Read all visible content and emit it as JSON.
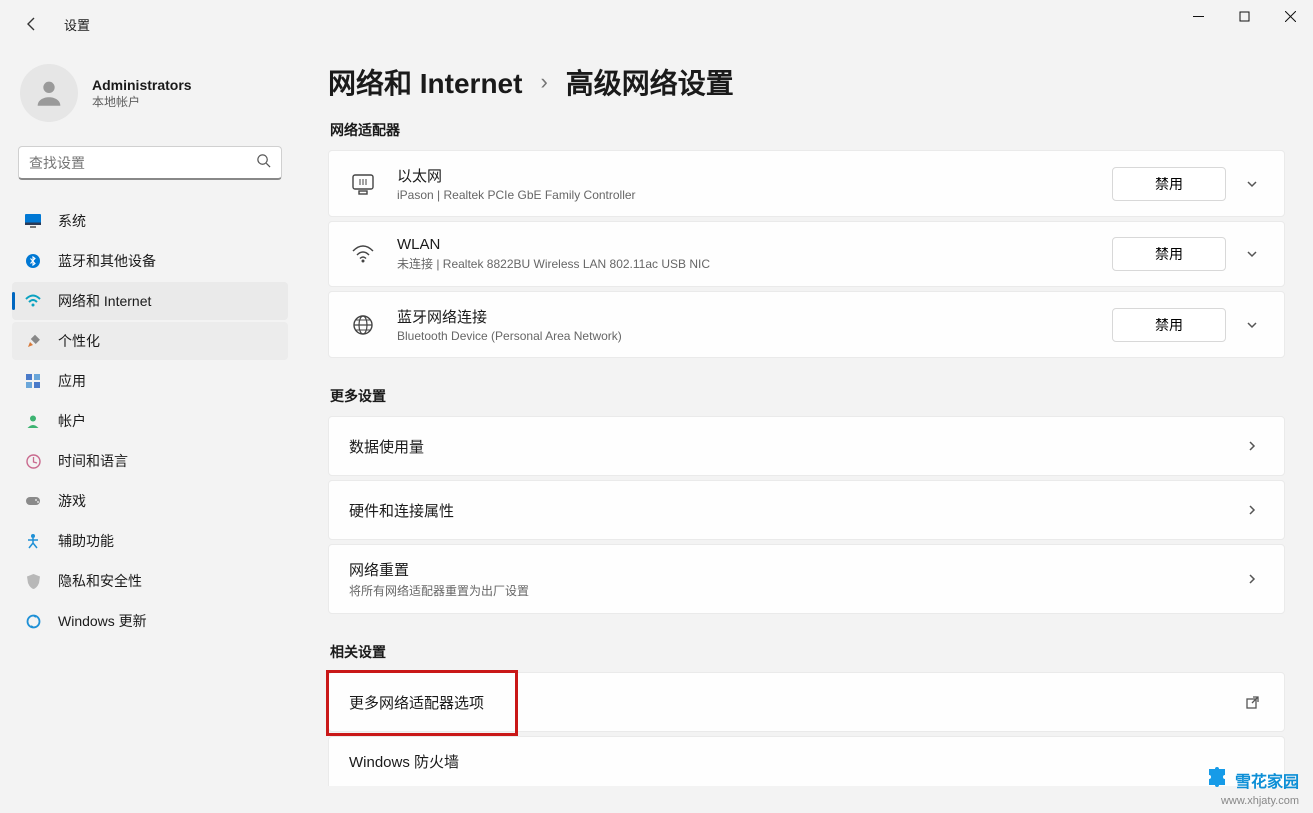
{
  "window": {
    "title": "设置"
  },
  "user": {
    "name": "Administrators",
    "sub": "本地帐户"
  },
  "search": {
    "placeholder": "查找设置"
  },
  "nav": {
    "system": "系统",
    "bluetooth": "蓝牙和其他设备",
    "network": "网络和 Internet",
    "personalize": "个性化",
    "apps": "应用",
    "accounts": "帐户",
    "time": "时间和语言",
    "gaming": "游戏",
    "accessibility": "辅助功能",
    "privacy": "隐私和安全性",
    "update": "Windows 更新"
  },
  "breadcrumb": {
    "parent": "网络和 Internet",
    "current": "高级网络设置"
  },
  "sections": {
    "adapters": "网络适配器",
    "more": "更多设置",
    "related": "相关设置"
  },
  "adapters": {
    "ethernet": {
      "title": "以太网",
      "sub": "iPason | Realtek PCIe GbE Family Controller",
      "btn": "禁用"
    },
    "wlan": {
      "title": "WLAN",
      "sub": "未连接 | Realtek 8822BU Wireless LAN 802.11ac USB NIC",
      "btn": "禁用"
    },
    "btnet": {
      "title": "蓝牙网络连接",
      "sub": "Bluetooth Device (Personal Area Network)",
      "btn": "禁用"
    }
  },
  "more": {
    "data": "数据使用量",
    "hardware": "硬件和连接属性",
    "reset_title": "网络重置",
    "reset_sub": "将所有网络适配器重置为出厂设置"
  },
  "related": {
    "more_adapters": "更多网络适配器选项",
    "firewall": "Windows 防火墙"
  },
  "watermark": {
    "brand": "雪花家园",
    "url": "www.xhjaty.com"
  }
}
